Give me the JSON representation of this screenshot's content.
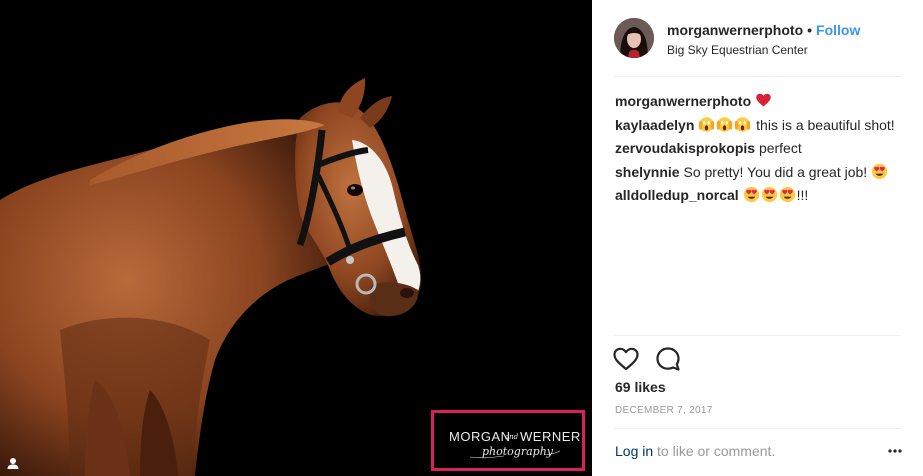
{
  "photo": {
    "alt": "Chestnut horse with white blaze wearing a bridle on black background",
    "watermark": {
      "line1": "MORGAN",
      "connector": "and",
      "line2": "WERNER",
      "script": "photography"
    }
  },
  "header": {
    "username": "morganwernerphoto",
    "separator": "•",
    "follow_label": "Follow",
    "location": "Big Sky Equestrian Center"
  },
  "comments": [
    {
      "user": "morganwernerphoto",
      "text": "",
      "emojis_before": [],
      "emojis_after": [
        "red-heart"
      ],
      "suffix": ""
    },
    {
      "user": "kaylaadelyn",
      "text": "this is a beautiful shot!",
      "emojis_before": [
        "screaming-face",
        "screaming-face",
        "screaming-face"
      ],
      "emojis_after": [],
      "suffix": ""
    },
    {
      "user": "zervoudakisprokopis",
      "text": "perfect",
      "emojis_before": [],
      "emojis_after": [],
      "suffix": ""
    },
    {
      "user": "shelynnie",
      "text": "So pretty! You did a great job!",
      "emojis_before": [],
      "emojis_after": [
        "heart-eyes-face"
      ],
      "suffix": ""
    },
    {
      "user": "alldolledup_norcal",
      "text": "",
      "emojis_before": [],
      "emojis_after": [
        "heart-eyes-face",
        "heart-eyes-face",
        "heart-eyes-face"
      ],
      "suffix": "!!!"
    }
  ],
  "actions": {
    "like_icon": "heart-outline-icon",
    "comment_icon": "comment-bubble-icon"
  },
  "likes": "69 likes",
  "date": "DECEMBER 7, 2017",
  "footer": {
    "login_label": "Log in",
    "login_suffix": " to like or comment.",
    "more_icon": "more-options-icon"
  },
  "colors": {
    "follow": "#3897f0",
    "link": "#003569",
    "muted": "#999999",
    "watermark_border": "#d9205a",
    "heart": "#ed4956"
  }
}
